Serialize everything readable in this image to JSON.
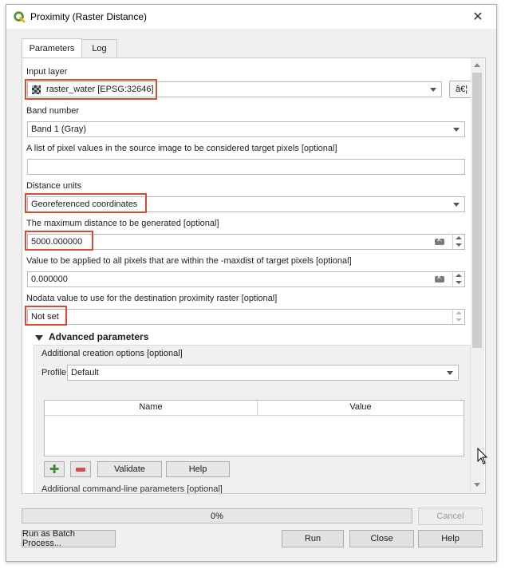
{
  "window": {
    "title": "Proximity (Raster Distance)",
    "close_glyph": "✕"
  },
  "tabs": [
    {
      "label": "Parameters",
      "active": true
    },
    {
      "label": "Log",
      "active": false
    }
  ],
  "form": {
    "input_layer": {
      "label": "Input layer",
      "value": "raster_water [EPSG:32646]",
      "side_button": "â€¦"
    },
    "band_number": {
      "label": "Band number",
      "value": "Band 1 (Gray)"
    },
    "target_pixels": {
      "label": "A list of pixel values in the source image to be considered target pixels [optional]",
      "value": ""
    },
    "distance_units": {
      "label": "Distance units",
      "value": "Georeferenced coordinates"
    },
    "max_distance": {
      "label": "The maximum distance to be generated [optional]",
      "value": "5000.000000"
    },
    "replace_value": {
      "label": "Value to be applied to all pixels that are within the -maxdist of target pixels [optional]",
      "value": "0.000000"
    },
    "nodata": {
      "label": "Nodata value to use for the destination proximity raster [optional]",
      "value": "Not set"
    }
  },
  "advanced": {
    "header": "Advanced parameters",
    "creation_options_label": "Additional creation options [optional]",
    "profile_label": "Profile",
    "profile_value": "Default",
    "table_headers": [
      "Name",
      "Value"
    ],
    "validate_label": "Validate",
    "help_label": "Help",
    "cmdline_label": "Additional command-line parameters [optional]"
  },
  "progress": {
    "text": "0%",
    "percent": 0
  },
  "buttons": {
    "cancel": "Cancel",
    "batch": "Run as Batch Process...",
    "run": "Run",
    "close": "Close",
    "help": "Help"
  },
  "colors": {
    "highlight": "#d84a32",
    "qgis_green": "#589632"
  }
}
